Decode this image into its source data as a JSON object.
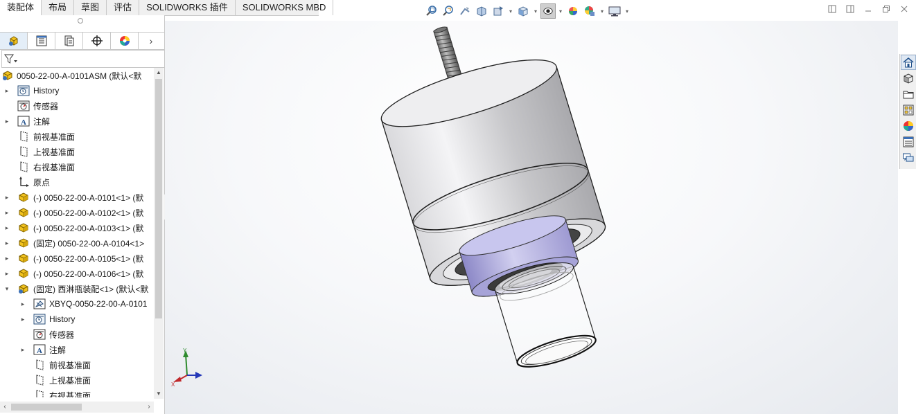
{
  "tabs": [
    {
      "label": "装配体",
      "active": true
    },
    {
      "label": "布局",
      "active": false
    },
    {
      "label": "草图",
      "active": false
    },
    {
      "label": "评估",
      "active": false
    },
    {
      "label": "SOLIDWORKS 插件",
      "active": false
    },
    {
      "label": "SOLIDWORKS MBD",
      "active": false
    }
  ],
  "manager_tabs": [
    "featuremanager",
    "propertymanager",
    "configurationmanager",
    "dimxpertmanager",
    "displaymanager"
  ],
  "tree": {
    "root": {
      "label": "0050-22-00-A-0101ASM  (默认<默"
    },
    "items": [
      {
        "label": "History",
        "icon": "history-icon",
        "expand": "▸"
      },
      {
        "label": "传感器",
        "icon": "sensor-icon",
        "expand": ""
      },
      {
        "label": "注解",
        "icon": "annotation-icon",
        "expand": "▸"
      },
      {
        "label": "前视基准面",
        "icon": "plane-icon",
        "expand": ""
      },
      {
        "label": "上视基准面",
        "icon": "plane-icon",
        "expand": ""
      },
      {
        "label": "右视基准面",
        "icon": "plane-icon",
        "expand": ""
      },
      {
        "label": "原点",
        "icon": "origin-icon",
        "expand": ""
      },
      {
        "label": "(-) 0050-22-00-A-0101<1> (默",
        "icon": "part-icon",
        "expand": "▸"
      },
      {
        "label": "(-) 0050-22-00-A-0102<1> (默",
        "icon": "part-icon",
        "expand": "▸"
      },
      {
        "label": "(-) 0050-22-00-A-0103<1> (默",
        "icon": "part-icon",
        "expand": "▸"
      },
      {
        "label": "(固定) 0050-22-00-A-0104<1>",
        "icon": "part-icon",
        "expand": "▸"
      },
      {
        "label": "(-) 0050-22-00-A-0105<1> (默",
        "icon": "part-icon",
        "expand": "▸"
      },
      {
        "label": "(-) 0050-22-00-A-0106<1> (默",
        "icon": "part-icon",
        "expand": "▸"
      },
      {
        "label": "(固定) 西淋瓶装配<1> (默认<默",
        "icon": "subassembly-icon",
        "expand": "▾"
      }
    ],
    "subitems": [
      {
        "label": "XBYQ-0050-22-00-A-0101",
        "icon": "xbyq-part-icon",
        "expand": "▸"
      },
      {
        "label": "History",
        "icon": "history-icon",
        "expand": "▸"
      },
      {
        "label": "传感器",
        "icon": "sensor-icon",
        "expand": ""
      },
      {
        "label": "注解",
        "icon": "annotation-icon",
        "expand": "▸"
      },
      {
        "label": "前视基准面",
        "icon": "plane-icon",
        "expand": ""
      },
      {
        "label": "上视基准面",
        "icon": "plane-icon",
        "expand": ""
      },
      {
        "label": "右视基准面",
        "icon": "plane-icon",
        "expand": ""
      }
    ]
  },
  "triad": {
    "x": "X",
    "y": "Y"
  },
  "colors": {
    "accent": "#1f5fa8",
    "part_yellow": "#e8c23a",
    "bore_lavender": "#b9b6e6",
    "axis_x": "#c0282b",
    "axis_y": "#2e8b2e",
    "axis_z": "#2438b8"
  }
}
